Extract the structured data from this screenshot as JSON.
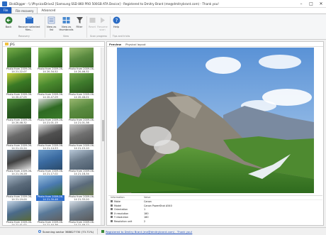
{
  "window": {
    "title": "DiskDigger - \\\\.\\PhysicalDrive2 [Samsung SSD 860 PRO 500GB ATA Device] - Registered to Dmitry Brant (me@dmitrybrant.com) - Thank you!",
    "minimize_icon": "minimize-icon",
    "maximize_icon": "maximize-icon",
    "close_icon": "close-icon"
  },
  "tabs": {
    "file": "File",
    "file_recovery": "File recovery",
    "advanced": "Advanced"
  },
  "ribbon": {
    "back": "Back",
    "recover_selected": "Recover selected files...",
    "view_as_list": "View as list",
    "view_as_thumbnails": "View as thumbnails",
    "filter": "Filter",
    "reset": "Reset",
    "resume_scan": "Resume scan",
    "help": "Help",
    "groups": {
      "recovery": "Recovery",
      "view": "View",
      "scan_progress": "Scan progress",
      "tips_and_tricks": "Tips and tricks"
    }
  },
  "folder": {
    "label": "JPG"
  },
  "thumbnails": [
    {
      "caption": "Photo from 2009-06-14 21-22-07",
      "colors": [
        "#3f7a2a",
        "#7ab04a",
        "#2e5a1e"
      ]
    },
    {
      "caption": "Photo from 2009-06-14 20-34-52",
      "colors": [
        "#4a8a30",
        "#8bc060",
        "#2a5a18"
      ]
    },
    {
      "caption": "Photo from 2009-06-14 20-46-32",
      "colors": [
        "#5a8a40",
        "#a0c070",
        "#3a6a28"
      ]
    },
    {
      "caption": "Photo from 2009-06-14 20-47-05",
      "colors": [
        "#3a7a25",
        "#c8d040",
        "#2a5518"
      ]
    },
    {
      "caption": "Photo from 2009-06-14 20-47-09",
      "colors": [
        "#4a8a2e",
        "#9ac055",
        "#30601e"
      ]
    },
    {
      "caption": "Photo from 2009-06-14 20-48-01",
      "colors": [
        "#3e7a2c",
        "#7aa850",
        "#2a521c"
      ]
    },
    {
      "caption": "Photo from 2009-06-14 20-48-32",
      "colors": [
        "#2a5a20",
        "#4e8a3a",
        "#1e4a16"
      ]
    },
    {
      "caption": "Photo from 2009-06-14 21-01-15",
      "colors": [
        "#2e6a22",
        "#dadada",
        "#3a7a2a"
      ]
    },
    {
      "caption": "Photo from 2009-06-14 21-01-38",
      "colors": [
        "#5a8a40",
        "#9ab870",
        "#4a7a30"
      ]
    },
    {
      "caption": "Photo from 2009-06-14 21-10-24",
      "colors": [
        "#6a6a6a",
        "#d8d8d8",
        "#4a4a4a"
      ]
    },
    {
      "caption": "Photo from 2009-06-14 21-14-53",
      "colors": [
        "#505050",
        "#e0e0e0",
        "#3a3a3a"
      ]
    },
    {
      "caption": "Photo from 2009-06-14 21-15-10",
      "colors": [
        "#707070",
        "#c8c8c8",
        "#505050"
      ]
    },
    {
      "caption": "Photo from 2009-06-14 21-16-28",
      "colors": [
        "#404040",
        "#7a8a9a",
        "#e8e8e8"
      ]
    },
    {
      "caption": "Photo from 2009-06-14 21-17-02",
      "colors": [
        "#3a6aa0",
        "#6a9ac8",
        "#2a4a6a"
      ]
    },
    {
      "caption": "Photo from 2009-06-14 21-18-34",
      "colors": [
        "#6a7a8a",
        "#b8c8d8",
        "#4a5a6a"
      ]
    },
    {
      "caption": "Photo from 2009-06-14 21-19-00",
      "colors": [
        "#5a6a7a",
        "#a8b8c8",
        "#3a4a5a"
      ]
    },
    {
      "caption": "Photo from 2009-06-14 21-30-48",
      "colors": [
        "#4a7ab0",
        "#9ac0e0",
        "#3a6a30"
      ]
    },
    {
      "caption": "Photo from 2009-06-14 21-33-20",
      "colors": [
        "#5a6a7a",
        "#b0c0d0",
        "#6a7a50"
      ]
    },
    {
      "caption": "Photo from 2009-06-14 21-41-02",
      "colors": [
        "#4a6a8a",
        "#c8d8e8",
        "#5a6a3a"
      ]
    },
    {
      "caption": "Photo from 2009-06-14 21-44-36",
      "colors": [
        "#5a7a9a",
        "#d0e0f0",
        "#606060"
      ]
    },
    {
      "caption": "Photo from 2009-06-14 21-49-12",
      "colors": [
        "#6a7a8a",
        "#d8e0e8",
        "#5a5a5a"
      ]
    }
  ],
  "selected_index": 16,
  "preview_tabs": {
    "preview": "Preview",
    "physical_layout": "Physical layout"
  },
  "info": {
    "headers": [
      "Information",
      "Value"
    ],
    "rows": [
      {
        "key": "Make",
        "value": "Canon"
      },
      {
        "key": "Model",
        "value": "Canon PowerShot A540"
      },
      {
        "key": "Orientation",
        "value": "1"
      },
      {
        "key": "X resolution",
        "value": "180"
      },
      {
        "key": "Y resolution",
        "value": "180"
      },
      {
        "key": "Resolution unit",
        "value": "2"
      }
    ]
  },
  "status": {
    "scanning": "Scanning sector 368827730 (73.71%)",
    "registered": "Registered to Dmitry Brant (me@dmitrybrant.com) - Thank you!"
  },
  "colors": {
    "accent": "#1f5fbf",
    "selection": "#2f6fcf"
  }
}
